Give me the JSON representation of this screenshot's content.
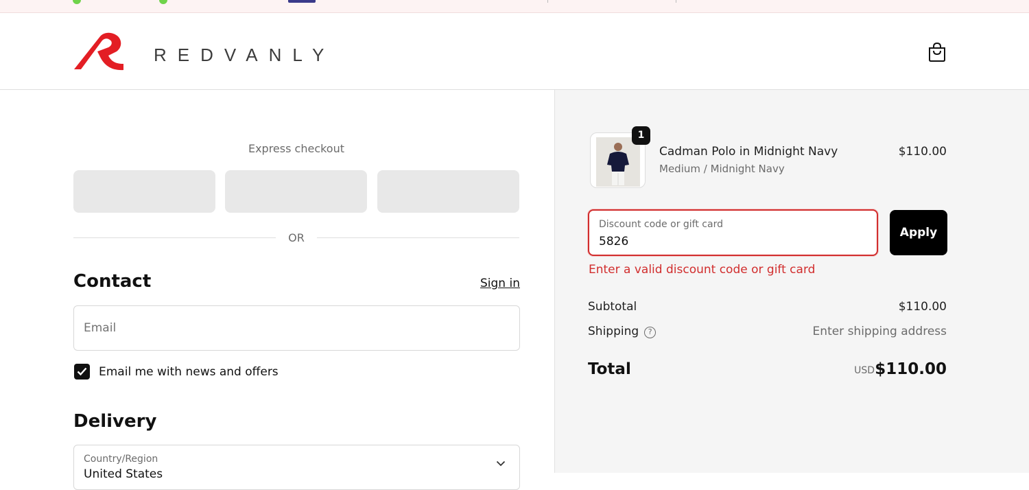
{
  "brand": {
    "name": "REDVANLY",
    "accent": "#e31e24"
  },
  "header": {
    "cart_icon": "shopping-bag-icon"
  },
  "express": {
    "title": "Express checkout",
    "divider": "OR"
  },
  "contact": {
    "heading": "Contact",
    "sign_in": "Sign in",
    "email_placeholder": "Email",
    "newsletter_label": "Email me with news and offers",
    "newsletter_checked": true
  },
  "delivery": {
    "heading": "Delivery",
    "country_label": "Country/Region",
    "country_value": "United States"
  },
  "summary": {
    "item": {
      "name": "Cadman Polo in Midnight Navy",
      "variant": "Medium / Midnight Navy",
      "price": "$110.00",
      "quantity": "1"
    },
    "discount": {
      "label": "Discount code or gift card",
      "value": "5826",
      "apply": "Apply",
      "error": "Enter a valid discount code or gift card",
      "error_color": "#d12d2d"
    },
    "subtotal_label": "Subtotal",
    "subtotal_value": "$110.00",
    "shipping_label": "Shipping",
    "shipping_value": "Enter shipping address",
    "total_label": "Total",
    "total_currency": "USD",
    "total_value": "$110.00"
  }
}
